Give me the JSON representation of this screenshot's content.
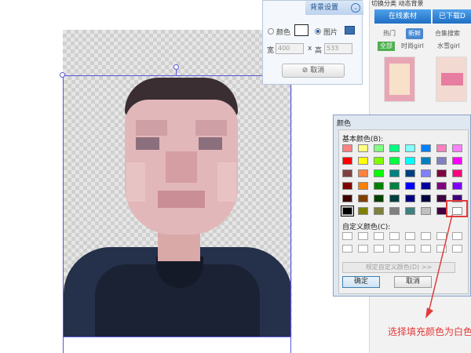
{
  "background_panel": {
    "title": "背景设置",
    "option_color": "颜色",
    "option_image": "图片",
    "width_label": "宽",
    "width_value": "400",
    "x_symbol": "x",
    "height_label": "高",
    "height_value": "533",
    "cancel_label": "取消"
  },
  "right_panel": {
    "top_tabs": "切换分类  动态背景",
    "tab_online": "在线素材",
    "tab_downloaded": "已下载D",
    "subtab_hot": "热门",
    "subtab_new": "新鲜",
    "subtab_collection": "合集搜索",
    "filter_all": "全部",
    "filter_fashion": "时尚girl",
    "filter_sweet": "水雪girl"
  },
  "color_dialog": {
    "title": "颜色",
    "basic_label": "基本颜色(B):",
    "custom_label": "自定义颜色(C):",
    "define_custom_label": "规定自定义颜色(D) >>",
    "ok_label": "确定",
    "cancel_label": "取消",
    "basic_colors": [
      [
        "#ff8080",
        "#ffff80",
        "#80ff80",
        "#00ff80",
        "#80ffff",
        "#0080ff",
        "#ff80c0",
        "#ff80ff"
      ],
      [
        "#ff0000",
        "#ffff00",
        "#80ff00",
        "#00ff40",
        "#00ffff",
        "#0080c0",
        "#8080c0",
        "#ff00ff"
      ],
      [
        "#804040",
        "#ff8040",
        "#00ff00",
        "#008080",
        "#004080",
        "#8080ff",
        "#800040",
        "#ff0080"
      ],
      [
        "#800000",
        "#ff8000",
        "#008000",
        "#008040",
        "#0000ff",
        "#0000a0",
        "#800080",
        "#8000ff"
      ],
      [
        "#400000",
        "#804000",
        "#004000",
        "#004040",
        "#000080",
        "#000040",
        "#400040",
        "#400080"
      ],
      [
        "#000000",
        "#808000",
        "#808040",
        "#808080",
        "#408080",
        "#c0c0c0",
        "#400040",
        "#ffffff"
      ]
    ],
    "selected_color": "#000000"
  },
  "annotation": {
    "text": "选择填充颜色为白色",
    "color": "#e23b3b"
  }
}
